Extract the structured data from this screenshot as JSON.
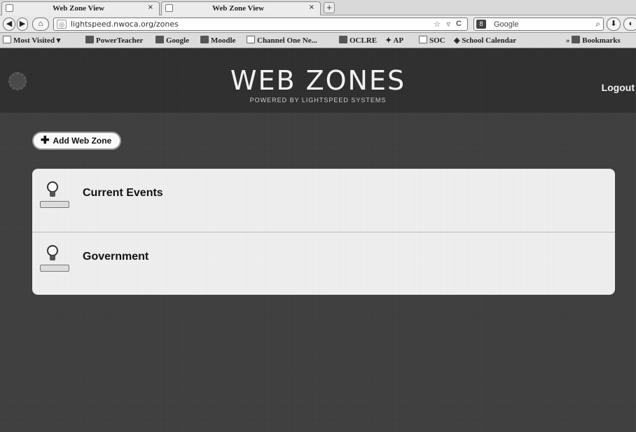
{
  "browser": {
    "tabs": [
      {
        "title": "Web Zone View",
        "close": "×"
      },
      {
        "title": "Web Zone View",
        "close": "×"
      }
    ],
    "new_tab": "+",
    "url": "lightspeed.nwoca.org/zones",
    "search_engine": "Google",
    "bookmarks": [
      "Most Visited",
      "PowerTeacher",
      "Google",
      "Moodle",
      "Channel One Ne...",
      "OCLRE",
      "AP",
      "SOC",
      "School Calendar",
      "Bookmarks"
    ]
  },
  "header": {
    "title": "WEB ZONES",
    "subtitle": "POWERED BY LIGHTSPEED SYSTEMS",
    "logout": "Logout"
  },
  "toolbar": {
    "add_label": "Add Web Zone"
  },
  "zones": [
    {
      "name": "Current Events"
    },
    {
      "name": "Government"
    }
  ]
}
